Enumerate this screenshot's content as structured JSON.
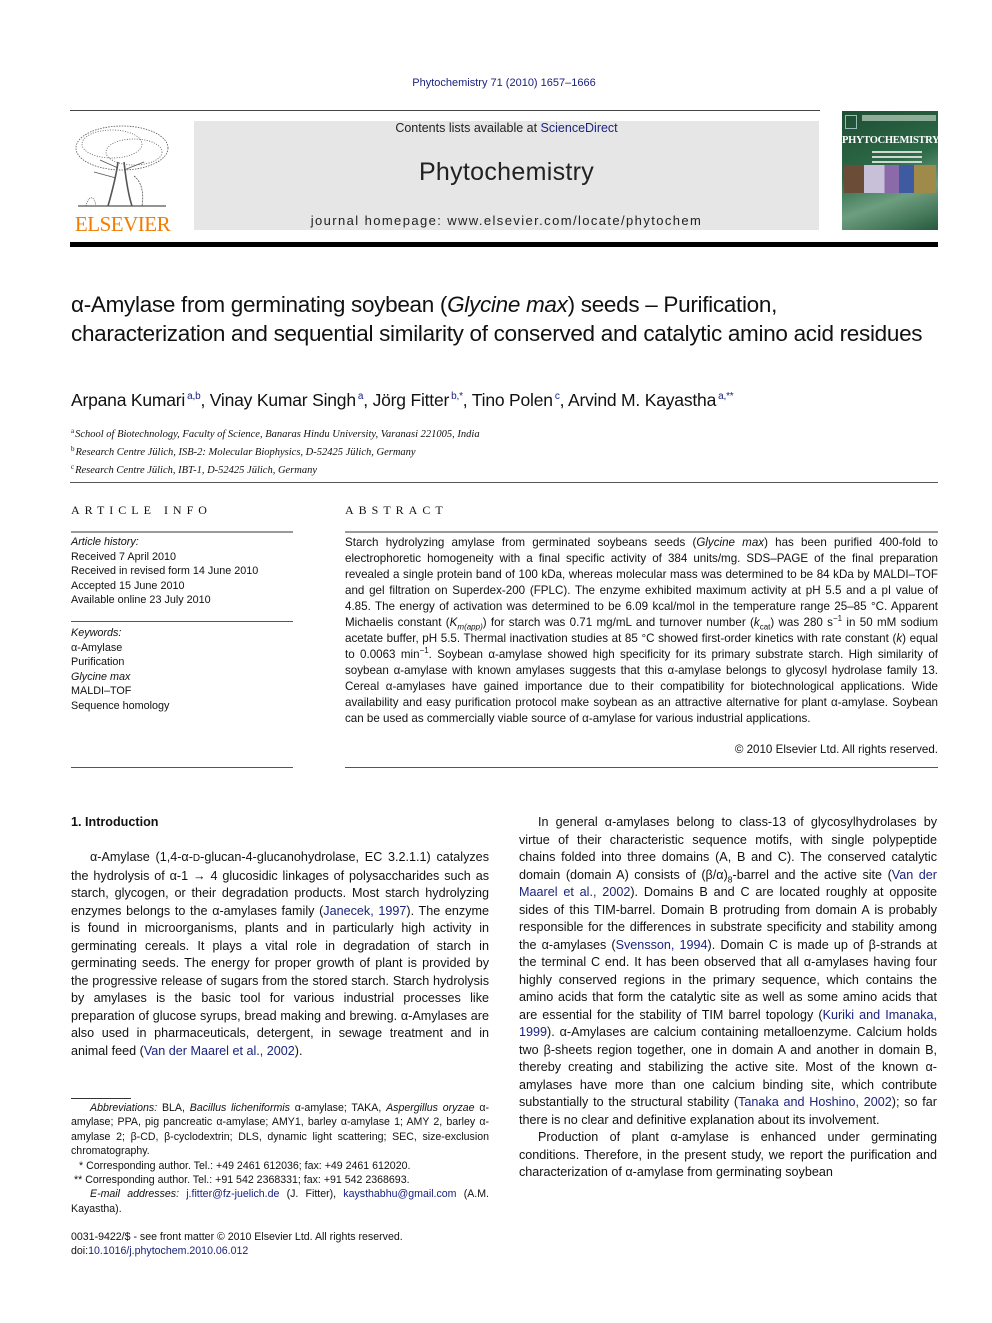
{
  "header": {
    "journal_ref": "Phytochemistry 71 (2010) 1657–1666",
    "contents_prefix": "Contents lists available at ",
    "contents_link": "ScienceDirect",
    "journal_name": "Phytochemistry",
    "homepage": "journal homepage: www.elsevier.com/locate/phytochem",
    "publisher_logo_text": "ELSEVIER",
    "cover_title": "PHYTOCHEMISTRY",
    "colors": {
      "link": "#1a237e",
      "elsevier_orange": "#f07c00",
      "masthead_bg": "#e6e6e6",
      "cover_green": "#2c6a47"
    }
  },
  "article": {
    "title_part1": "α-Amylase from germinating soybean (",
    "title_italic": "Glycine max",
    "title_part2": ") seeds – Purification, characterization and sequential similarity of conserved and catalytic amino acid residues",
    "authors": [
      {
        "name": "Arpana Kumari",
        "sup": "a,b",
        "sep": ", "
      },
      {
        "name": "Vinay Kumar Singh",
        "sup": "a",
        "sep": ", "
      },
      {
        "name": "Jörg Fitter",
        "sup": "b,*",
        "sep": ", "
      },
      {
        "name": "Tino Polen",
        "sup": "c",
        "sep": ", "
      },
      {
        "name": "Arvind M. Kayastha",
        "sup": "a,**",
        "sep": ""
      }
    ],
    "affiliations": [
      {
        "mark": "a",
        "text": "School of Biotechnology, Faculty of Science, Banaras Hindu University, Varanasi 221005, India"
      },
      {
        "mark": "b",
        "text": "Research Centre Jülich, ISB-2: Molecular Biophysics, D-52425 Jülich, Germany"
      },
      {
        "mark": "c",
        "text": "Research Centre Jülich, IBT-1, D-52425 Jülich, Germany"
      }
    ]
  },
  "article_info": {
    "heading": "ARTICLE INFO",
    "history_label": "Article history:",
    "history": [
      "Received 7 April 2010",
      "Received in revised form 14 June 2010",
      "Accepted 15 June 2010",
      "Available online 23 July 2010"
    ],
    "keywords_label": "Keywords:",
    "keywords": [
      "α-Amylase",
      "Purification",
      "Glycine max",
      "MALDI–TOF",
      "Sequence homology"
    ]
  },
  "abstract": {
    "heading": "ABSTRACT",
    "t1": "Starch hydrolyzing amylase from germinated soybeans seeds (",
    "t1_it": "Glycine max",
    "t2": ") has been purified 400-fold to electrophoretic homogeneity with a final specific activity of 384 units/mg. SDS–PAGE of the final preparation revealed a single protein band of 100 kDa, whereas molecular mass was determined to be 84 kDa by MALDI–TOF and gel filtration on Superdex-200 (FPLC). The enzyme exhibited maximum activity at pH 5.5 and a pI value of 4.85. The energy of activation was determined to be 6.09 kcal/mol in the temperature range 25–85 °C. Apparent Michaelis constant (",
    "km": "K",
    "km_sub": "m(app)",
    "t3": ") for starch was 0.71 mg/mL and turnover number (",
    "kcat": "k",
    "kcat_sub": "cat",
    "t4": ") was 280 s",
    "sup1": "−1",
    "t5": " in 50 mM sodium acetate buffer, pH 5.5. Thermal inactivation studies at 85 °C showed first-order kinetics with rate constant (",
    "k": "k",
    "t6": ") equal to 0.0063 min",
    "sup2": "−1",
    "t7": ". Soybean α-amylase showed high specificity for its primary substrate starch. High similarity of soybean α-amylase with known amylases suggests that this α-amylase belongs to glycosyl hydrolase family 13. Cereal α-amylases have gained importance due to their compatibility for biotechnological applications. Wide availability and easy purification protocol make soybean as an attractive alternative for plant α-amylase. Soybean can be used as commercially viable source of α-amylase for various industrial applications.",
    "copyright": "© 2010 Elsevier Ltd. All rights reserved."
  },
  "introduction": {
    "heading": "1. Introduction",
    "p1_a": "α-Amylase (1,4-α-",
    "p1_d": "D",
    "p1_b": "-glucan-4-glucanohydrolase, EC 3.2.1.1) catalyzes the hydrolysis of α-1 → 4 glucosidic linkages of polysaccharides such as starch, glycogen, or their degradation products. Most starch hydrolyzing enzymes belongs to the α-amylases family (",
    "p1_ref1": "Janecek, 1997",
    "p1_c": "). The enzyme is found in microorganisms, plants and in particularly high activity in germinating cereals. It plays a vital role in degradation of starch in germinating seeds. The energy for proper growth of plant is provided by the progressive release of sugars from the stored starch. Starch hydrolysis by amylases is the basic tool for various industrial processes like preparation of glucose syrups, bread making and brewing. α-Amylases are also used in pharmaceuticals, detergent, in sewage treatment and in animal feed (",
    "p1_ref2": "Van der Maarel et al., 2002",
    "p1_d2": ").",
    "p2_a": "In general α-amylases belong to class-13 of glycosylhydrolases by virtue of their characteristic sequence motifs, with single polypeptide chains folded into three domains (A, B and C). The conserved catalytic domain (domain A) consists of (β/α)",
    "p2_sub": "8",
    "p2_b": "-barrel and the active site (",
    "p2_ref1": "Van der Maarel et al., 2002",
    "p2_c": "). Domains B and C are located roughly at opposite sides of this TIM-barrel. Domain B protruding from domain A is probably responsible for the differences in substrate specificity and stability among the α-amylases (",
    "p2_ref2": "Svensson, 1994",
    "p2_d": "). Domain C is made up of β-strands at the terminal C end. It has been observed that all α-amylases having four highly conserved regions in the primary sequence, which contains the amino acids that form the catalytic site as well as some amino acids that are essential for the stability of TIM barrel topology (",
    "p2_ref3": "Kuriki and Imanaka, 1999",
    "p2_e": "). α-Amylases are calcium containing metalloenzyme. Calcium holds two β-sheets region together, one in domain A and another in domain B, thereby creating and stabilizing the active site. Most of the known α-amylases have more than one calcium binding site, which contribute substantially to the structural stability (",
    "p2_ref4": "Tanaka and Hoshino, 2002",
    "p2_f": "); so far there is no clear and definitive explanation about its involvement.",
    "p3": "Production of plant α-amylase is enhanced under germinating conditions. Therefore, in the present study, we report the purification and characterization of α-amylase from germinating soybean"
  },
  "footnotes": {
    "abbr_label": "Abbreviations:",
    "abbr_a": " BLA, ",
    "abbr_it1": "Bacillus licheniformis",
    "abbr_b": " α-amylase; TAKA, ",
    "abbr_it2": "Aspergillus oryzae",
    "abbr_c": " α-amylase; PPA, pig pancreatic α-amylase; AMY1, barley α-amylase 1; AMY 2, barley α-amylase 2; β-CD, β-cyclodextrin; DLS, dynamic light scattering; SEC, size-exclusion chromatography.",
    "corr1": "* Corresponding author. Tel.: +49 2461 612036; fax: +49 2461 612020.",
    "corr2": "** Corresponding author. Tel.: +91 542 2368331; fax: +91 542 2368693.",
    "email_label": "E-mail addresses:",
    "email1": "j.fitter@fz-juelich.de",
    "email1_who": " (J. Fitter), ",
    "email2": "kaysthabhu@gmail.com",
    "email2_who": " (A.M. Kayastha)."
  },
  "front_matter": {
    "issn": "0031-9422/$ - see front matter © 2010 Elsevier Ltd. All rights reserved.",
    "doi_label": "doi:",
    "doi": "10.1016/j.phytochem.2010.06.012"
  }
}
